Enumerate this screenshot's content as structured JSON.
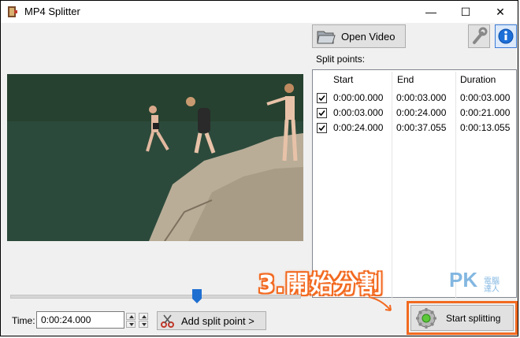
{
  "window": {
    "title": "MP4 Splitter",
    "minimize": "—",
    "maximize": "☐",
    "close": "✕"
  },
  "toolbar": {
    "open_video_label": "Open Video",
    "tools_icon": "wrench-icon",
    "info_icon": "info-icon"
  },
  "split_points": {
    "label": "Split points:",
    "columns": [
      "Start",
      "End",
      "Duration"
    ],
    "rows": [
      {
        "checked": true,
        "start": "0:00:00.000",
        "end": "0:00:03.000",
        "duration": "0:00:03.000"
      },
      {
        "checked": true,
        "start": "0:00:03.000",
        "end": "0:00:24.000",
        "duration": "0:00:21.000"
      },
      {
        "checked": true,
        "start": "0:00:24.000",
        "end": "0:00:37.055",
        "duration": "0:00:13.055"
      }
    ]
  },
  "timeline": {
    "position_fraction": 0.645
  },
  "controls": {
    "time_label": "Time:",
    "time_value": "0:00:24.000",
    "add_split_label": "Add split point >",
    "start_label": "Start splitting"
  },
  "annotation": {
    "text": "3.開始分割",
    "color": "#f26a21"
  },
  "watermark": {
    "text": "PK",
    "sub1": "電腦",
    "sub2": "達人"
  }
}
